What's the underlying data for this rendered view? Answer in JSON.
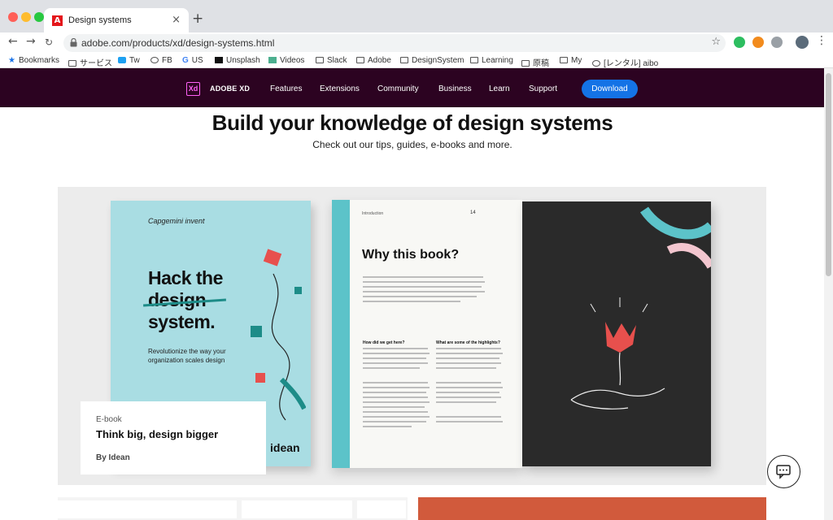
{
  "browser": {
    "tab_title": "Design systems",
    "tab_close": "×",
    "new_tab": "+",
    "back": "←",
    "forward": "→",
    "reload": "C",
    "url": "adobe.com/products/xd/design-systems.html",
    "star": "☆"
  },
  "bookmarks": [
    {
      "label": "Bookmarks",
      "icon": "star-icon"
    },
    {
      "label": "サービス",
      "icon": "folder-icon"
    },
    {
      "label": "Tw",
      "icon": "twitter-icon"
    },
    {
      "label": "FB",
      "icon": "globe-icon"
    },
    {
      "label": "US",
      "icon": "google-icon"
    },
    {
      "label": "Unsplash",
      "icon": "unsplash-icon"
    },
    {
      "label": "Videos",
      "icon": "video-icon"
    },
    {
      "label": "Slack",
      "icon": "folder-icon"
    },
    {
      "label": "Adobe",
      "icon": "folder-icon"
    },
    {
      "label": "DesignSystem",
      "icon": "folder-icon"
    },
    {
      "label": "Learning",
      "icon": "folder-icon"
    },
    {
      "label": "原稿",
      "icon": "folder-icon"
    },
    {
      "label": "My",
      "icon": "folder-icon"
    },
    {
      "label": "[レンタル] aibo",
      "icon": "globe-icon"
    }
  ],
  "adobe_nav": {
    "logo": "Xd",
    "brand": "ADOBE XD",
    "links": [
      "Features",
      "Extensions",
      "Community",
      "Business",
      "Learn",
      "Support"
    ],
    "download": "Download"
  },
  "main": {
    "headline": "Build your knowledge of design systems",
    "subhead": "Check out our tips, guides, e-books and more."
  },
  "book": {
    "cover_brand": "Capgemini invent",
    "cover_title_1": "Hack the",
    "cover_title_2": "design",
    "cover_title_3": "system.",
    "cover_sub": "Revolutionize the way your organization scales design",
    "cover_footer": "idean",
    "page_section": "Introduction",
    "page_number": "14",
    "page_title": "Why this book?",
    "subhead_left": "How did we get here?",
    "subhead_right": "What are some of the highlights?"
  },
  "card": {
    "type": "E-book",
    "title": "Think big, design bigger",
    "author": "By Idean"
  },
  "colors": {
    "nav_bg": "#2c0321",
    "download": "#1473e6",
    "xd_accent": "#ff61f6"
  }
}
